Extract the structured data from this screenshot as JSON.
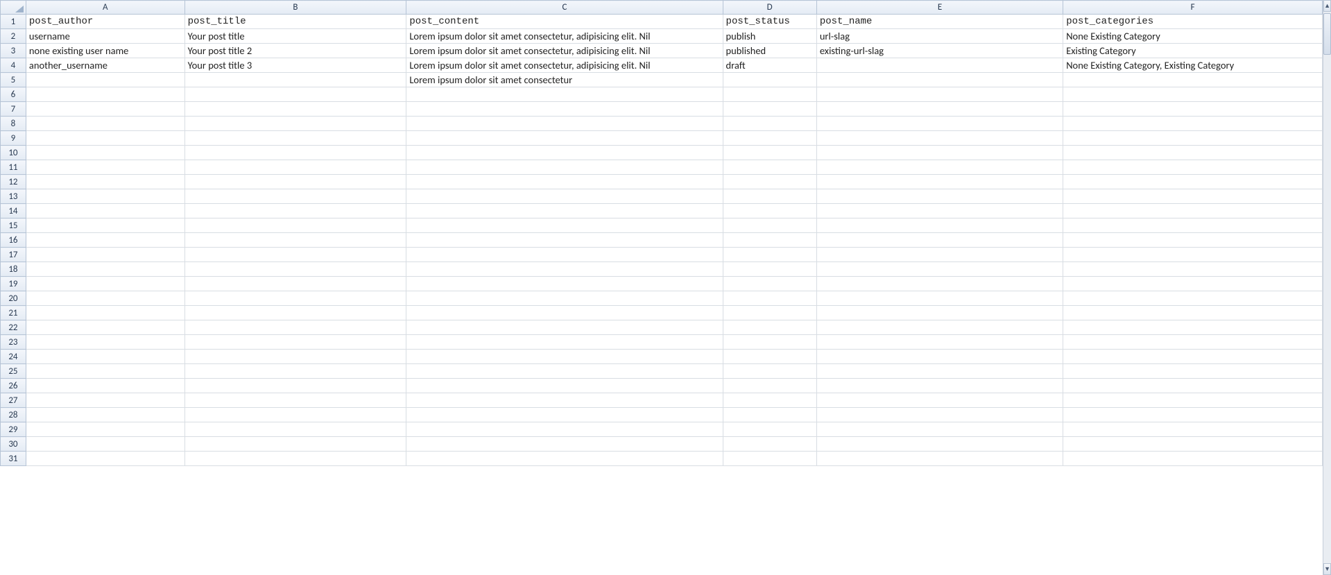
{
  "columns": [
    "A",
    "B",
    "C",
    "D",
    "E",
    "F"
  ],
  "rowCount": 31,
  "headerRow": {
    "A": "post_author",
    "B": "post_title",
    "C": "post_content",
    "D": "post_status",
    "E": "post_name",
    "F": "post_categories"
  },
  "dataRows": [
    {
      "A": "username",
      "B": "Your post title",
      "C": "Lorem ipsum dolor sit amet consectetur, adipisicing elit. Nil",
      "D": "publish",
      "E": "url-slag",
      "F": "None Existing Category"
    },
    {
      "A": "none existing user name",
      "B": "Your post title 2",
      "C": "Lorem ipsum dolor sit amet consectetur, adipisicing elit. Nil",
      "D": "published",
      "E": "existing-url-slag",
      "F": "Existing Category"
    },
    {
      "A": "another_username",
      "B": "Your post title 3",
      "C": "Lorem ipsum dolor sit amet consectetur, adipisicing elit. Nil",
      "D": "draft",
      "E": "",
      "F": "None Existing Category, Existing Category"
    },
    {
      "A": "",
      "B": "",
      "C": "Lorem ipsum dolor sit amet consectetur",
      "D": "",
      "E": "",
      "F": ""
    }
  ],
  "scrollbar": {
    "upGlyph": "▲",
    "downGlyph": "▼"
  }
}
